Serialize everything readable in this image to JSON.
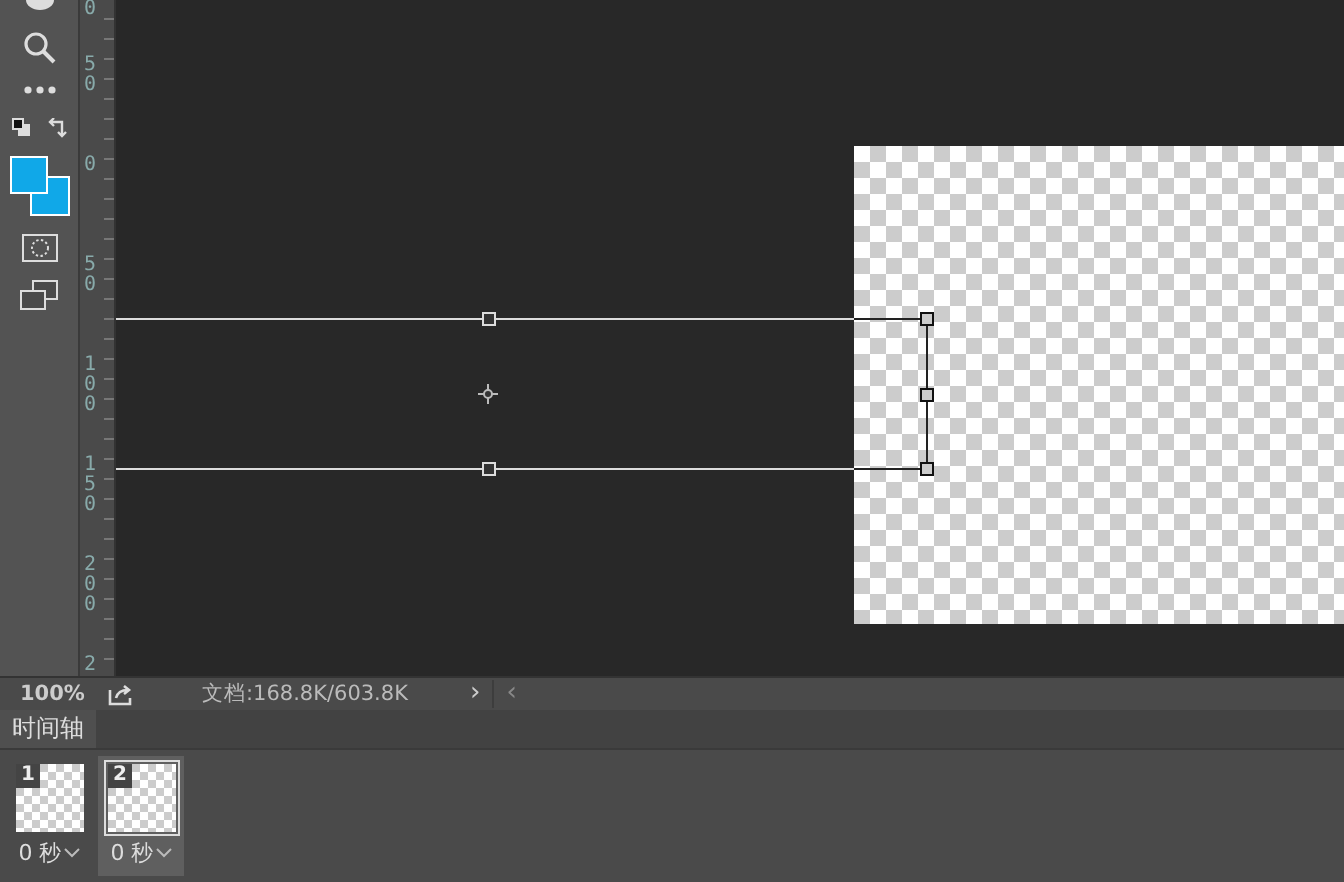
{
  "ruler": {
    "labels": [
      "0",
      "50",
      "0",
      "50",
      "100",
      "150",
      "200",
      "2"
    ]
  },
  "status_bar": {
    "zoom": "100%",
    "document": "文档:168.8K/603.8K",
    "next": "›",
    "prev": "‹"
  },
  "timeline": {
    "tab": {
      "label": "时间轴",
      "selected": true
    },
    "frames": [
      {
        "number": "1",
        "delay": "0 秒",
        "selected": false
      },
      {
        "number": "2",
        "delay": "0 秒",
        "selected": true
      }
    ]
  }
}
